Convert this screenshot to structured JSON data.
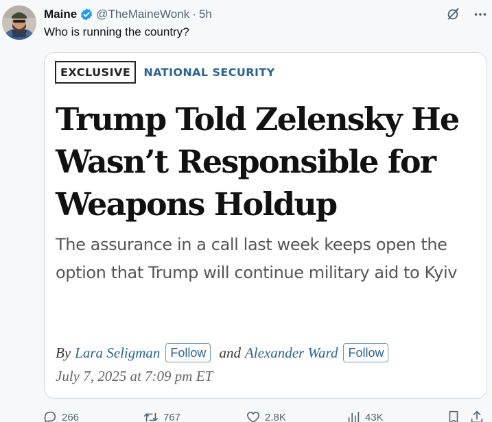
{
  "post": {
    "author_name": "Maine",
    "handle": "@TheMaineWonk",
    "separator": "·",
    "time": "5h",
    "text": "Who is running the country?"
  },
  "card": {
    "tag": "EXCLUSIVE",
    "section": "NATIONAL SECURITY",
    "headline": "Trump Told Zelensky He Wasn’t Responsible for Weapons Holdup",
    "dek": "The assurance in a call last week keeps open the option that Trump will continue military aid to Kyiv",
    "byline_prefix": "By",
    "author1": "Lara Seligman",
    "and": "and",
    "author2": "Alexander Ward",
    "follow_label": "Follow",
    "date": "July 7, 2025 at 7:09 pm ET"
  },
  "actions": {
    "replies": "266",
    "reposts": "767",
    "likes": "2.8K",
    "views": "43K"
  },
  "colors": {
    "verified": "#1d9bf0",
    "wsj_blue": "#2a6496",
    "muted": "#536471"
  },
  "icons": [
    "grok-icon",
    "more-icon",
    "verified-icon",
    "reply-icon",
    "repost-icon",
    "like-icon",
    "views-icon",
    "bookmark-icon",
    "share-icon"
  ]
}
